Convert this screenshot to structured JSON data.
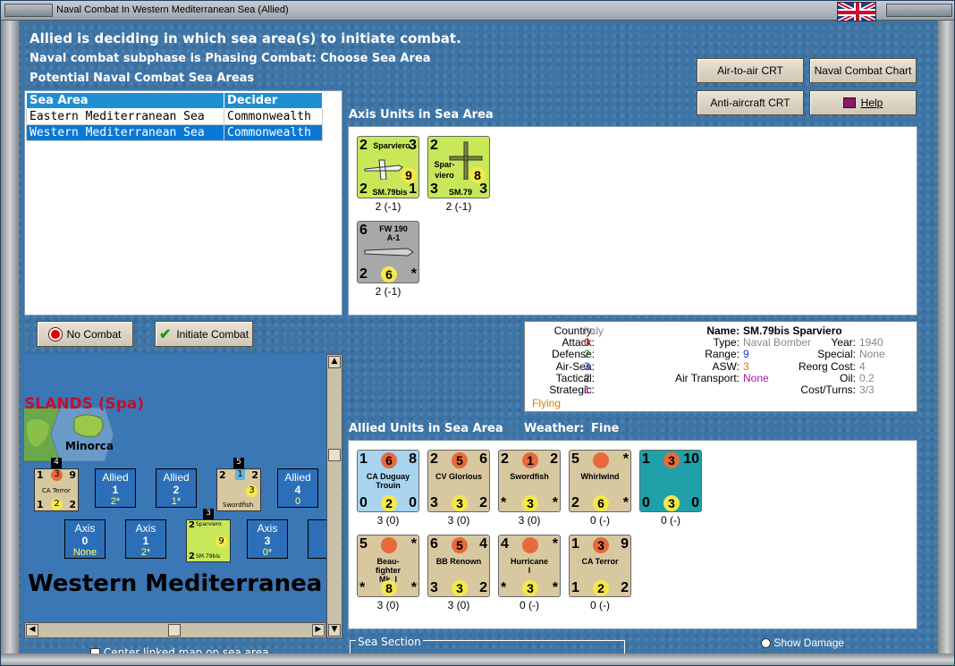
{
  "window": {
    "title": "Naval Combat In Western Mediterranean Sea (Allied)"
  },
  "header": {
    "line1": "Allied is deciding in which sea area(s) to initiate combat.",
    "line2": "Naval combat subphase is Phasing Combat: Choose Sea Area",
    "line3": "Potential Naval Combat Sea Areas"
  },
  "buttons": {
    "air_to_air": "Air-to-air CRT",
    "naval_chart": "Naval Combat Chart",
    "anti_aircraft": "Anti-aircraft CRT",
    "help": "Help",
    "no_combat": "No Combat",
    "initiate_combat": "Initiate Combat"
  },
  "sea_table": {
    "headers": [
      "Sea Area",
      "Decider"
    ],
    "rows": [
      [
        "Eastern Mediterranean Sea",
        "Commonwealth"
      ],
      [
        "Western Mediterranean Sea",
        "Commonwealth"
      ]
    ],
    "selected": 1
  },
  "axis_section": {
    "title": "Axis Units in Sea Area",
    "units": [
      {
        "name1": "Sparviero",
        "name2": "SM.79bis",
        "tl": "2",
        "tr": "3",
        "mid": "9",
        "bl": "2",
        "br": "1",
        "cap": "2 (-1)"
      },
      {
        "name1": "Spar-",
        "name1b": "viero",
        "name2": "SM.79",
        "tl": "2",
        "tr": "",
        "mid": "8",
        "bl": "3",
        "br": "3",
        "cap": "2 (-1)"
      },
      {
        "name1": "FW 190",
        "name1b": "A-1",
        "name2": "",
        "tl": "6",
        "tr": "",
        "mid": "6",
        "bl": "2",
        "br": "*",
        "cap": "2 (-1)"
      }
    ]
  },
  "info": {
    "country_label": "Country:",
    "country": "Italy",
    "attack_label": "Attack:",
    "attack": "0",
    "defense_label": "Defense:",
    "defense": "2",
    "airsea_label": "Air-Sea:",
    "airsea": "3",
    "tactical_label": "Tactical:",
    "tactical": "2",
    "strategic_label": "Strategic:",
    "strategic": "1",
    "status": "Flying",
    "name_label": "Name:",
    "name": "SM.79bis Sparviero",
    "type_label": "Type:",
    "type": "Naval Bomber",
    "year_label": "Year:",
    "year": "1940",
    "range_label": "Range:",
    "range": "9",
    "special_label": "Special:",
    "special": "None",
    "asw_label": "ASW:",
    "asw": "3",
    "reorg_label": "Reorg Cost:",
    "reorg": "4",
    "airtrans_label": "Air Transport:",
    "airtrans": "None",
    "oil_label": "Oil:",
    "oil": "0.2",
    "costturns_label": "Cost/Turns:",
    "costturns": "3/3"
  },
  "allied_section": {
    "title": "Allied Units in Sea Area",
    "weather_label": "Weather:",
    "weather": "Fine",
    "units": [
      {
        "name1": "CA Duguay",
        "name1b": "Trouin",
        "tl": "1",
        "tm": "6",
        "tr": "8",
        "bl": "0",
        "bm": "2",
        "br": "0",
        "cap": "3 (0)",
        "color": "#a8d4f0"
      },
      {
        "name1": "CV Glorious",
        "name1b": "",
        "tl": "2",
        "tm": "5",
        "tr": "6",
        "bl": "3",
        "bm": "3",
        "br": "2",
        "cap": "3 (0)",
        "color": "#d8c8a0"
      },
      {
        "name1": "Swordfish",
        "name1b": "",
        "tl": "2",
        "tm": "1",
        "tr": "2",
        "bl": "*",
        "bm": "3",
        "br": "*",
        "cap": "3 (0)",
        "color": "#d8c8a0"
      },
      {
        "name1": "Whirlwind",
        "name1b": "",
        "tl": "5",
        "tm": "",
        "tr": "*",
        "bl": "2",
        "bm": "6",
        "br": "*",
        "cap": "0 (-)",
        "color": "#d8c8a0"
      },
      {
        "name1": "",
        "name1b": "",
        "tl": "1",
        "tm": "3",
        "tr": "10",
        "bl": "0",
        "bm": "3",
        "br": "0",
        "cap": "0 (-)",
        "color": "#20a0a8"
      },
      {
        "name1": "Beau-",
        "name1b": "fighter",
        "name2": "Mk. I",
        "tl": "5",
        "tm": "",
        "tr": "*",
        "bl": "*",
        "bm": "8",
        "br": "*",
        "cap": "3 (0)",
        "color": "#d8c8a0"
      },
      {
        "name1": "BB Renown",
        "name1b": "",
        "tl": "6",
        "tm": "5",
        "tr": "4",
        "bl": "3",
        "bm": "3",
        "br": "2",
        "cap": "3 (0)",
        "color": "#d8c8a0"
      },
      {
        "name1": "Hurricane",
        "name1b": "I",
        "tl": "4",
        "tm": "",
        "tr": "*",
        "bl": "*",
        "bm": "3",
        "br": "*",
        "cap": "0 (-)",
        "color": "#d8c8a0"
      },
      {
        "name1": "CA Terror",
        "name1b": "",
        "tl": "1",
        "tm": "3",
        "tr": "9",
        "bl": "1",
        "bm": "2",
        "br": "2",
        "cap": "0 (-)",
        "color": "#d8c8a0"
      }
    ]
  },
  "map": {
    "region": "SLANDS (Spa)",
    "island": "Minorca",
    "sea_name": "Western Mediterranea",
    "allied_boxes": [
      {
        "t": "Allied",
        "v": "1",
        "s": "2*"
      },
      {
        "t": "Allied",
        "v": "2",
        "s": "1*"
      },
      {
        "t": "Allied",
        "v": "4",
        "s": "0"
      }
    ],
    "axis_boxes": [
      {
        "t": "Axis",
        "v": "0",
        "s": "None"
      },
      {
        "t": "Axis",
        "v": "1",
        "s": "2*"
      },
      {
        "t": "Axis",
        "v": "3",
        "s": "0*"
      }
    ],
    "counter_labels": {
      "ca_terror": "CA Terror",
      "swordfish": "Swordfish",
      "sparviero": "Sparviero",
      "sm79bis": "SM.79bis"
    },
    "badges": {
      "b4": "4",
      "b5": "5",
      "b3": "3"
    }
  },
  "footer": {
    "center_link": "Center linked map on sea area",
    "sea_section": "Sea Section",
    "show_damage": "Show Damage"
  },
  "colors": {
    "accent": "#0a78d7",
    "panel_blue": "#3d74a6",
    "counter_italy": "#c8e85a",
    "counter_germany": "#a8a8a8"
  }
}
